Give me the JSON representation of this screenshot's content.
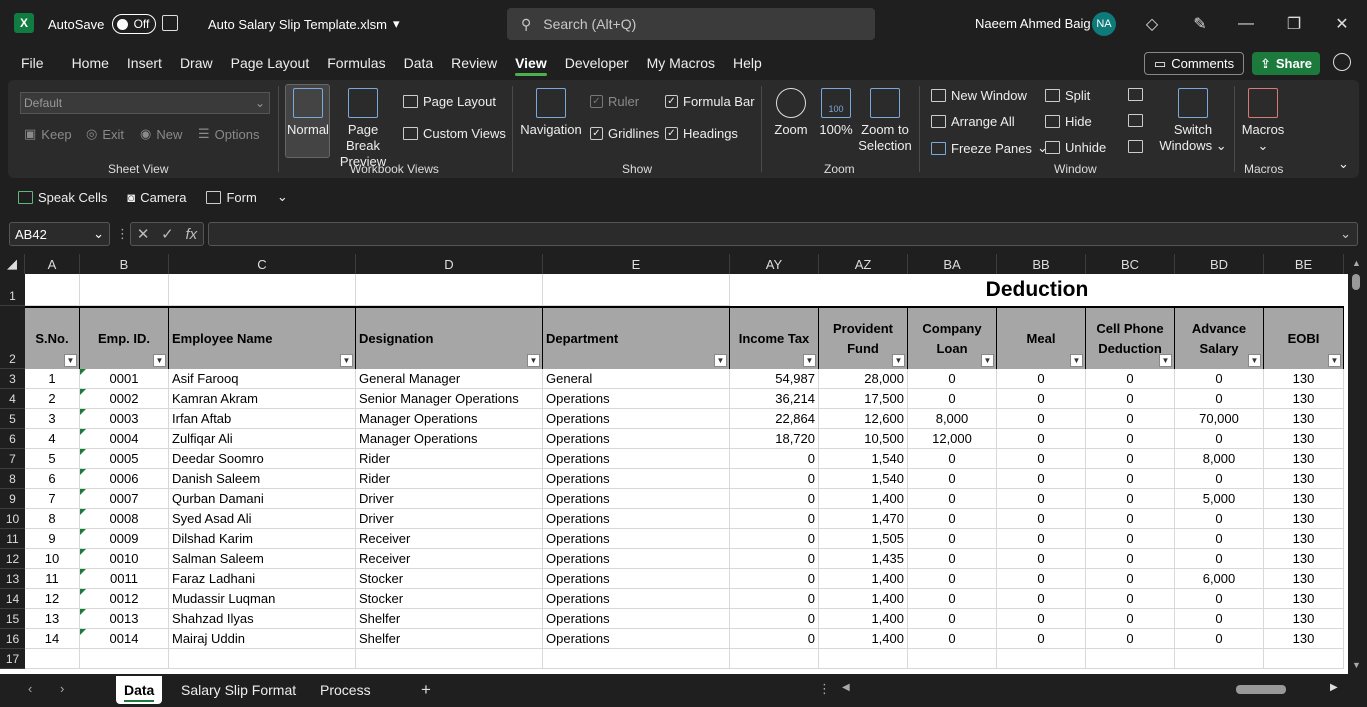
{
  "app": {
    "logo": "X",
    "autosave_label": "AutoSave",
    "autosave_state": "Off",
    "filename": "Auto Salary Slip Template.xlsm",
    "search_placeholder": "Search (Alt+Q)",
    "user_name": "Naeem Ahmed Baig",
    "user_initials": "NA"
  },
  "menu": [
    "File",
    "Home",
    "Insert",
    "Draw",
    "Page Layout",
    "Formulas",
    "Data",
    "Review",
    "View",
    "Developer",
    "My Macros",
    "Help"
  ],
  "menu_active": "View",
  "header_buttons": {
    "comments": "Comments",
    "share": "Share"
  },
  "ribbon": {
    "sheet_view": {
      "combo": "Default",
      "keep": "Keep",
      "exit": "Exit",
      "new": "New",
      "options": "Options",
      "label": "Sheet View"
    },
    "workbook_views": {
      "normal": "Normal",
      "page_break_1": "Page Break",
      "page_break_2": "Preview",
      "page_layout": "Page Layout",
      "custom_views": "Custom Views",
      "label": "Workbook Views"
    },
    "show": {
      "navigation": "Navigation",
      "ruler": "Ruler",
      "formula_bar": "Formula Bar",
      "gridlines": "Gridlines",
      "headings": "Headings",
      "label": "Show"
    },
    "zoom": {
      "zoom": "Zoom",
      "hundred": "100%",
      "hundred_icon": "100",
      "zoom_sel_1": "Zoom to",
      "zoom_sel_2": "Selection",
      "label": "Zoom"
    },
    "window": {
      "new_window": "New Window",
      "arrange_all": "Arrange All",
      "freeze_panes": "Freeze Panes",
      "split": "Split",
      "hide": "Hide",
      "unhide": "Unhide",
      "switch_1": "Switch",
      "switch_2": "Windows",
      "label": "Window"
    },
    "macros": {
      "macros": "Macros",
      "label": "Macros"
    }
  },
  "qat": {
    "speak_cells": "Speak Cells",
    "camera": "Camera",
    "form": "Form"
  },
  "formula_bar": {
    "name_box": "AB42",
    "fx": "fx",
    "value": ""
  },
  "columns": [
    "A",
    "B",
    "C",
    "D",
    "E",
    "AY",
    "AZ",
    "BA",
    "BB",
    "BC",
    "BD",
    "BE"
  ],
  "row_numbers": [
    "1",
    "2",
    "3",
    "4",
    "5",
    "6",
    "7",
    "8",
    "9",
    "10",
    "11",
    "12",
    "13",
    "14",
    "15",
    "16",
    "17"
  ],
  "section_title": "Deduction",
  "headers": [
    {
      "l1": "S.No.",
      "l2": ""
    },
    {
      "l1": "Emp. ID.",
      "l2": ""
    },
    {
      "l1": "Employee Name",
      "l2": ""
    },
    {
      "l1": "Designation",
      "l2": ""
    },
    {
      "l1": "Department",
      "l2": ""
    },
    {
      "l1": "Income Tax",
      "l2": ""
    },
    {
      "l1": "Provident",
      "l2": "Fund"
    },
    {
      "l1": "Company",
      "l2": "Loan"
    },
    {
      "l1": "Meal",
      "l2": ""
    },
    {
      "l1": "Cell Phone",
      "l2": "Deduction"
    },
    {
      "l1": "Advance",
      "l2": "Salary"
    },
    {
      "l1": "EOBI",
      "l2": ""
    }
  ],
  "rows": [
    [
      "1",
      "0001",
      "Asif Farooq",
      "General Manager",
      "General",
      "54,987",
      "28,000",
      "0",
      "0",
      "0",
      "0",
      "130"
    ],
    [
      "2",
      "0002",
      "Kamran Akram",
      "Senior Manager Operations",
      "Operations",
      "36,214",
      "17,500",
      "0",
      "0",
      "0",
      "0",
      "130"
    ],
    [
      "3",
      "0003",
      "Irfan Aftab",
      "Manager Operations",
      "Operations",
      "22,864",
      "12,600",
      "8,000",
      "0",
      "0",
      "70,000",
      "130"
    ],
    [
      "4",
      "0004",
      "Zulfiqar Ali",
      "Manager Operations",
      "Operations",
      "18,720",
      "10,500",
      "12,000",
      "0",
      "0",
      "0",
      "130"
    ],
    [
      "5",
      "0005",
      "Deedar Soomro",
      "Rider",
      "Operations",
      "0",
      "1,540",
      "0",
      "0",
      "0",
      "8,000",
      "130"
    ],
    [
      "6",
      "0006",
      "Danish Saleem",
      "Rider",
      "Operations",
      "0",
      "1,540",
      "0",
      "0",
      "0",
      "0",
      "130"
    ],
    [
      "7",
      "0007",
      "Qurban Damani",
      "Driver",
      "Operations",
      "0",
      "1,400",
      "0",
      "0",
      "0",
      "5,000",
      "130"
    ],
    [
      "8",
      "0008",
      "Syed Asad Ali",
      "Driver",
      "Operations",
      "0",
      "1,470",
      "0",
      "0",
      "0",
      "0",
      "130"
    ],
    [
      "9",
      "0009",
      "Dilshad Karim",
      "Receiver",
      "Operations",
      "0",
      "1,505",
      "0",
      "0",
      "0",
      "0",
      "130"
    ],
    [
      "10",
      "0010",
      "Salman Saleem",
      "Receiver",
      "Operations",
      "0",
      "1,435",
      "0",
      "0",
      "0",
      "0",
      "130"
    ],
    [
      "11",
      "0011",
      "Faraz Ladhani",
      "Stocker",
      "Operations",
      "0",
      "1,400",
      "0",
      "0",
      "0",
      "6,000",
      "130"
    ],
    [
      "12",
      "0012",
      "Mudassir Luqman",
      "Stocker",
      "Operations",
      "0",
      "1,400",
      "0",
      "0",
      "0",
      "0",
      "130"
    ],
    [
      "13",
      "0013",
      "Shahzad Ilyas",
      "Shelfer",
      "Operations",
      "0",
      "1,400",
      "0",
      "0",
      "0",
      "0",
      "130"
    ],
    [
      "14",
      "0014",
      "Mairaj Uddin",
      "Shelfer",
      "Operations",
      "0",
      "1,400",
      "0",
      "0",
      "0",
      "0",
      "130"
    ]
  ],
  "sheet_tabs": [
    "Data",
    "Salary Slip Format",
    "Process"
  ],
  "active_tab": "Data",
  "colors": {
    "accent": "#1b7a3c",
    "header_fill": "#a6a6a6"
  }
}
